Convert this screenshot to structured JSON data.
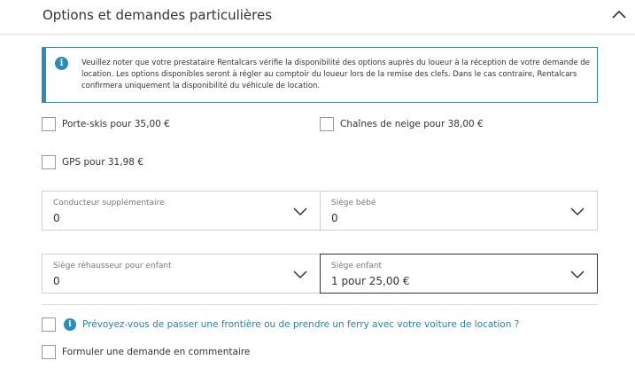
{
  "section": {
    "title": "Options et demandes particulières"
  },
  "info": {
    "icon": "info-icon",
    "line1": "Veuillez noter que votre prestataire Rentalcars vérifie la disponibilité des options auprès du loueur à la réception de votre demande de",
    "line2": "location. Les options disponibles seront à régler au comptoir du loueur lors de la remise des clefs. Dans le cas contraire, Rentalcars",
    "line3": "confirmera uniquement la disponibilité du véhicule de location."
  },
  "options": {
    "ski_rack": {
      "label": "Porte-skis pour 35,00 €",
      "checked": false
    },
    "snow_chains": {
      "label": "Chaînes de neige pour 38,00 €",
      "checked": false
    },
    "gps": {
      "label": "GPS pour 31,98 €",
      "checked": false
    }
  },
  "selects": {
    "additional_driver": {
      "label": "Conducteur supplémentaire",
      "value": "0"
    },
    "baby_seat": {
      "label": "Siège bébé",
      "value": "0"
    },
    "booster_seat": {
      "label": "Siège réhausseur pour enfant",
      "value": "0"
    },
    "child_seat": {
      "label": "Siège enfant",
      "value": "1 pour 25,00 €"
    }
  },
  "extra": {
    "border_ferry": {
      "label": "Prévoyez-vous de passer une frontière ou de prendre un ferry avec votre voiture de location ?",
      "checked": false
    },
    "comment_request": {
      "label": "Formuler une demande en commentaire",
      "checked": false
    }
  },
  "colors": {
    "accent": "#2b8bbd",
    "link": "#2b7fb0",
    "border": "#cfcfcf",
    "active_border": "#333333"
  }
}
